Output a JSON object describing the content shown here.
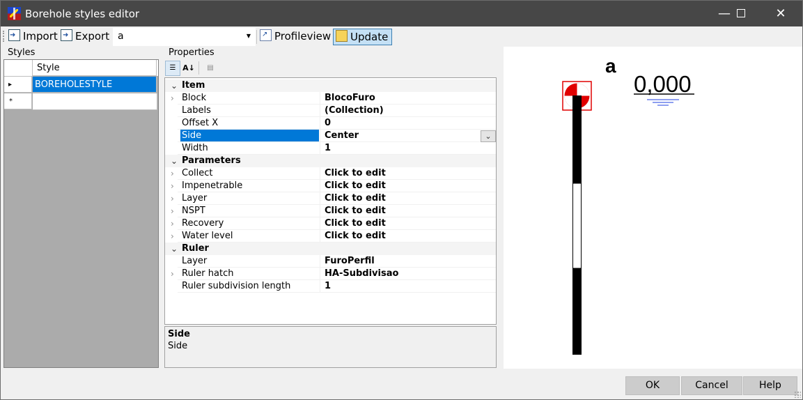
{
  "window": {
    "title": "Borehole styles editor",
    "minimize": "—",
    "maximize": "☐",
    "close": "✕"
  },
  "toolbar": {
    "import_label": "Import",
    "export_label": "Export",
    "combo_value": "a",
    "profileview_label": "Profileview",
    "update_label": "Update"
  },
  "styles": {
    "label": "Styles",
    "column_header": "Style",
    "rows": [
      "BOREHOLESTYLE"
    ],
    "new_row_marker": "*",
    "current_row_marker": "▸"
  },
  "properties": {
    "label": "Properties",
    "rows": [
      {
        "type": "cat",
        "expander": "⌄",
        "name": "Item"
      },
      {
        "type": "prop",
        "expander": "›",
        "name": "Block",
        "value": "BlocoFuro"
      },
      {
        "type": "prop",
        "expander": "",
        "name": "Labels",
        "value": "(Collection)"
      },
      {
        "type": "prop",
        "expander": "",
        "name": "Offset X",
        "value": "0"
      },
      {
        "type": "prop",
        "expander": "",
        "name": "Side",
        "value": "Center",
        "selected": true
      },
      {
        "type": "prop",
        "expander": "",
        "name": "Width",
        "value": "1"
      },
      {
        "type": "cat",
        "expander": "⌄",
        "name": "Parameters"
      },
      {
        "type": "prop",
        "expander": "›",
        "name": "Collect",
        "value": "Click to edit"
      },
      {
        "type": "prop",
        "expander": "›",
        "name": "Impenetrable",
        "value": "Click to edit"
      },
      {
        "type": "prop",
        "expander": "›",
        "name": "Layer",
        "value": "Click to edit"
      },
      {
        "type": "prop",
        "expander": "›",
        "name": "NSPT",
        "value": "Click to edit"
      },
      {
        "type": "prop",
        "expander": "›",
        "name": "Recovery",
        "value": "Click to edit"
      },
      {
        "type": "prop",
        "expander": "›",
        "name": "Water level",
        "value": "Click to edit"
      },
      {
        "type": "cat",
        "expander": "⌄",
        "name": "Ruler"
      },
      {
        "type": "prop",
        "expander": "",
        "name": "Layer",
        "value": "FuroPerfil"
      },
      {
        "type": "prop",
        "expander": "›",
        "name": "Ruler hatch",
        "value": "HA-Subdivisao"
      },
      {
        "type": "prop",
        "expander": "",
        "name": "Ruler subdivision length",
        "value": "1"
      }
    ],
    "description_title": "Side",
    "description_text": "Side"
  },
  "preview": {
    "label_text": "a",
    "elevation_text": "0,000"
  },
  "buttons": {
    "ok": "OK",
    "cancel": "Cancel",
    "help": "Help"
  }
}
